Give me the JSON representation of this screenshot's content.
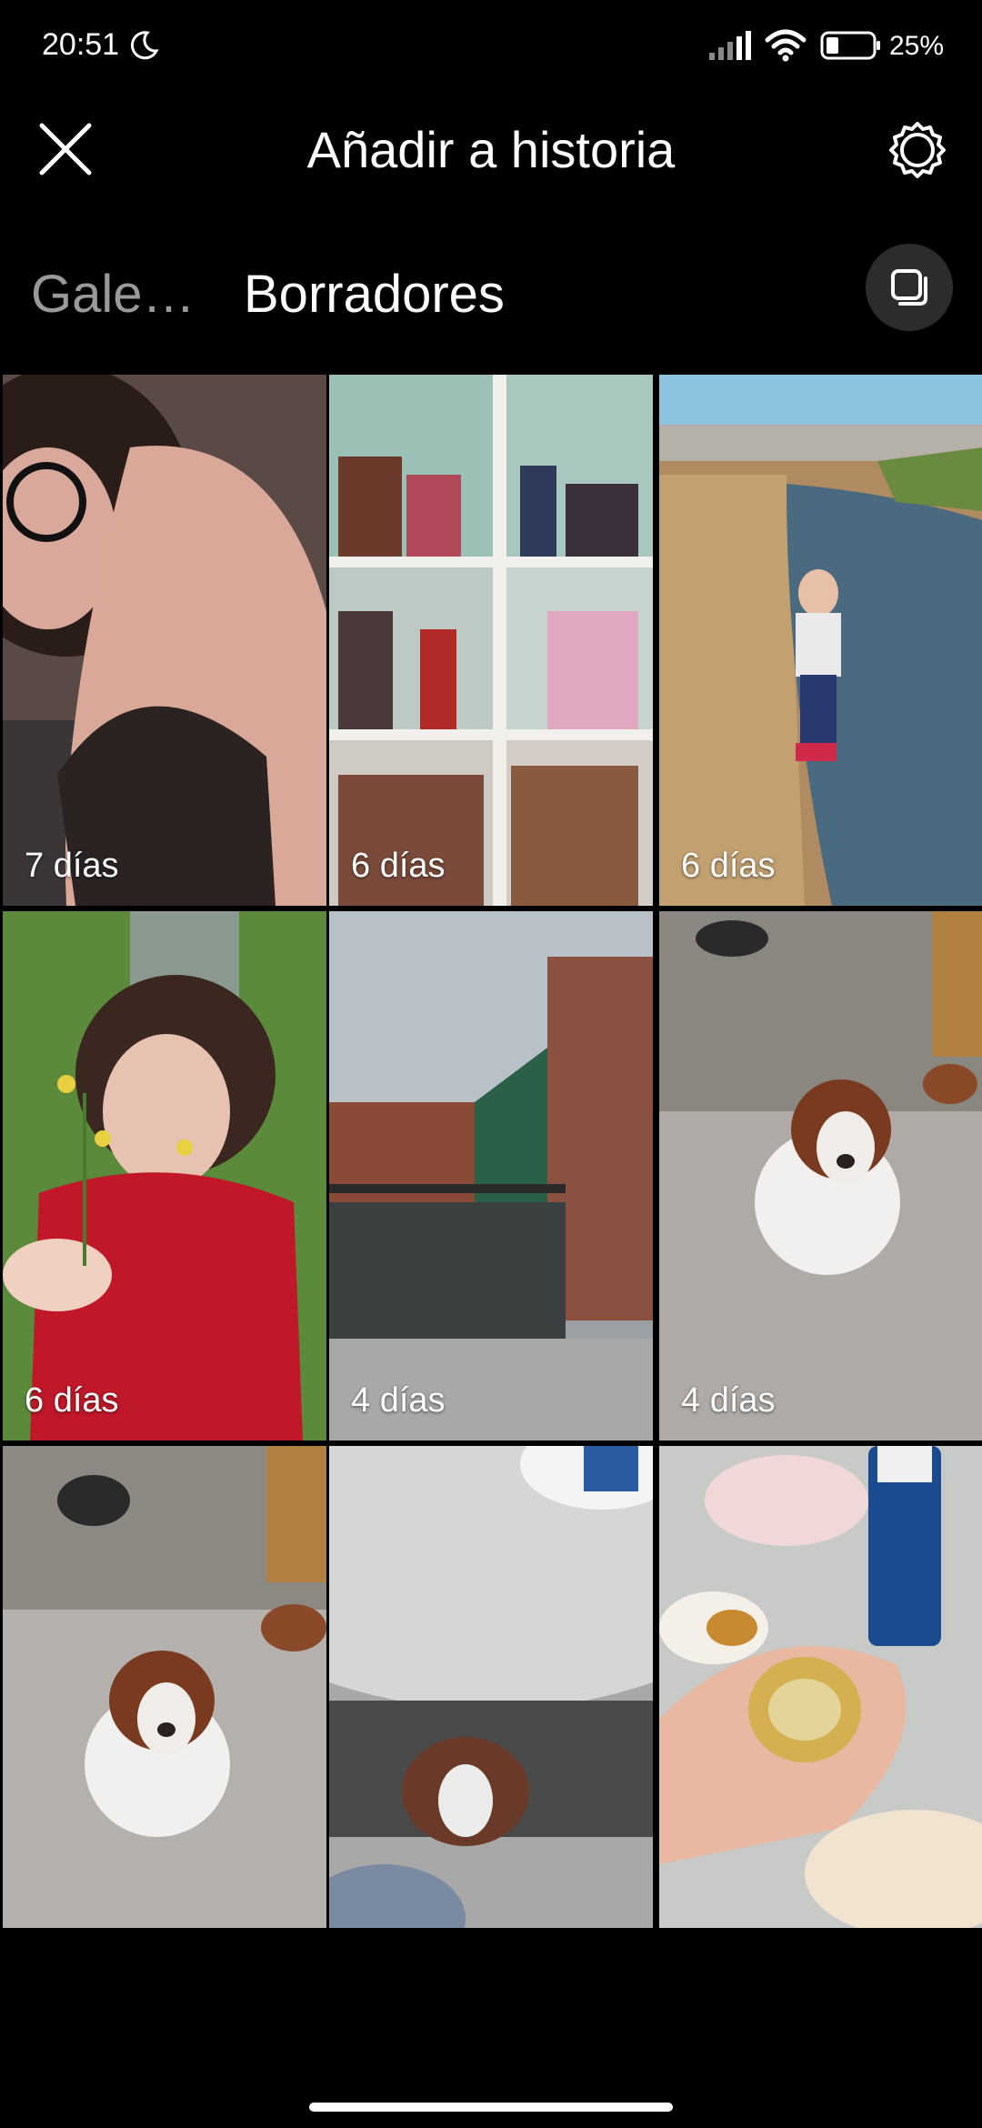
{
  "status_bar": {
    "time": "20:51",
    "battery_level": "25%",
    "icons": [
      "moon-icon",
      "signal-icon",
      "wifi-icon",
      "battery-icon"
    ]
  },
  "header": {
    "title": "Añadir a historia",
    "close_icon": "close-icon",
    "settings_icon": "gear-icon"
  },
  "tabs": [
    {
      "label": "Gale…",
      "active": false
    },
    {
      "label": "Borradores",
      "active": true
    }
  ],
  "multi_select_icon": "multi-select-icon",
  "drafts": [
    {
      "age": "7 días",
      "subject": "selfie"
    },
    {
      "age": "6 días",
      "subject": "bookshelf"
    },
    {
      "age": "6 días",
      "subject": "child-by-stream"
    },
    {
      "age": "6 días",
      "subject": "child-with-flowers"
    },
    {
      "age": "4 días",
      "subject": "balcony"
    },
    {
      "age": "4 días",
      "subject": "dog"
    },
    {
      "age": "",
      "subject": "dog"
    },
    {
      "age": "",
      "subject": "dog-under-table"
    },
    {
      "age": "",
      "subject": "food"
    }
  ],
  "colors": {
    "background": "#000000",
    "inactive_tab": "#9a9a9a",
    "active_tab": "#ffffff",
    "button_bg": "#2c2c2c"
  }
}
